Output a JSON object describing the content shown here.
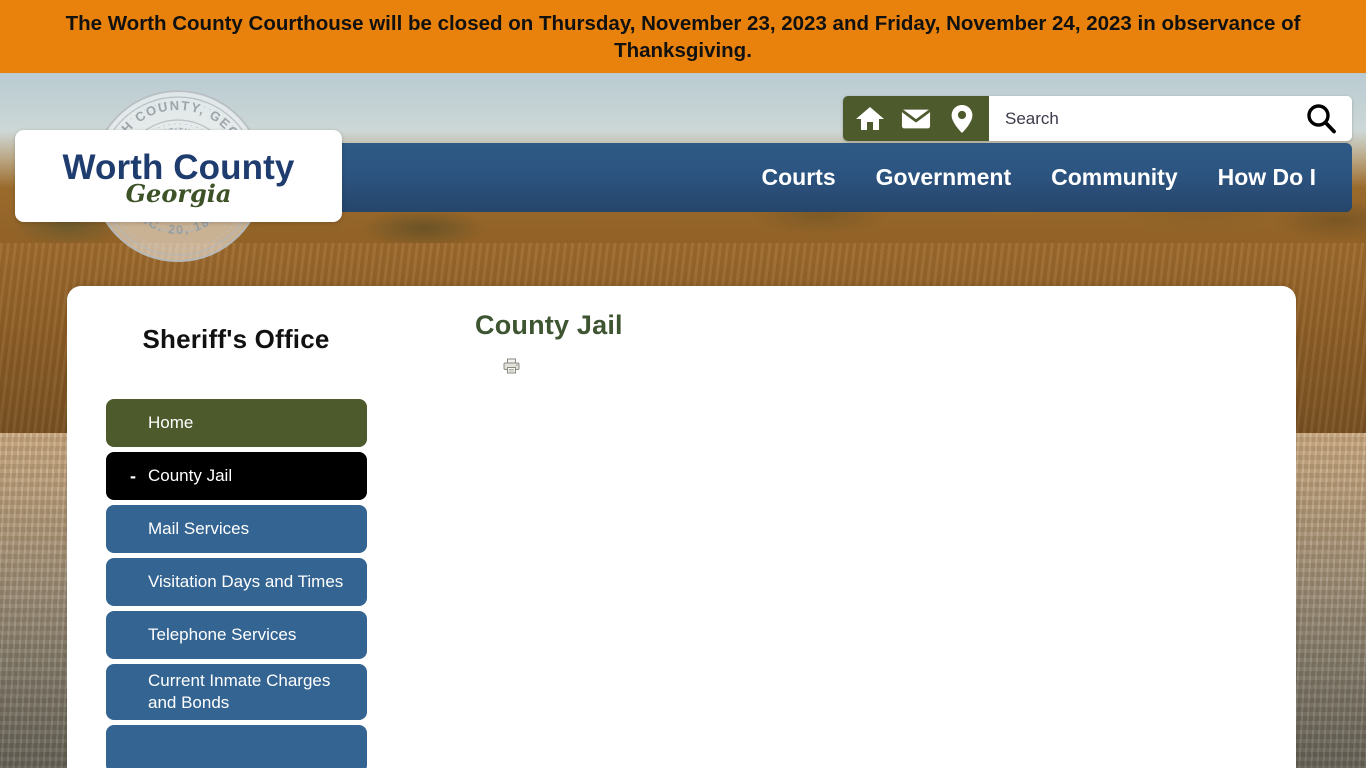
{
  "alert": {
    "message": "The Worth County Courthouse will be closed on Thursday, November 23, 2023 and Friday, November 24, 2023 in observance of Thanksgiving.",
    "background_color": "#e8820c",
    "text_color": "#111111"
  },
  "logo": {
    "title": "Worth County",
    "subtitle": "Georgia",
    "title_color": "#1f3c6e",
    "subtitle_color": "#3d5226",
    "seal": {
      "outer_text": "WORTH COUNTY, GEORGIA",
      "inner_text": "CONSTITUTION",
      "date_text": "DEC. 20, 1853",
      "icon": "county-seal-icon"
    }
  },
  "utility": {
    "icons": [
      {
        "name": "home-icon",
        "label": "Home"
      },
      {
        "name": "envelope-icon",
        "label": "Contact"
      },
      {
        "name": "map-pin-icon",
        "label": "Location"
      }
    ],
    "icon_bar_color": "#4c5a2c"
  },
  "search": {
    "value": "",
    "placeholder": "Search",
    "button_icon": "search-icon"
  },
  "nav": {
    "items": [
      {
        "label": "Courts"
      },
      {
        "label": "Government"
      },
      {
        "label": "Community"
      },
      {
        "label": "How Do I"
      }
    ],
    "background_color": "#2c5480"
  },
  "sidebar": {
    "title": "Sheriff's Office",
    "items": [
      {
        "label": "Home",
        "style": "home",
        "toggle": ""
      },
      {
        "label": "County Jail",
        "style": "active",
        "toggle": "-"
      },
      {
        "label": "Mail Services",
        "style": "default",
        "toggle": ""
      },
      {
        "label": "Visitation Days and Times",
        "style": "default",
        "toggle": ""
      },
      {
        "label": "Telephone Services",
        "style": "default",
        "toggle": ""
      },
      {
        "label": "Current Inmate Charges and Bonds",
        "style": "default",
        "toggle": ""
      },
      {
        "label": "",
        "style": "default",
        "toggle": ""
      }
    ],
    "colors": {
      "default": "#346491",
      "home": "#4c5a2c",
      "active": "#000000"
    }
  },
  "main": {
    "page_title": "County Jail",
    "page_title_color": "#3e5531",
    "print_icon": "printer-icon",
    "body_text": ""
  }
}
